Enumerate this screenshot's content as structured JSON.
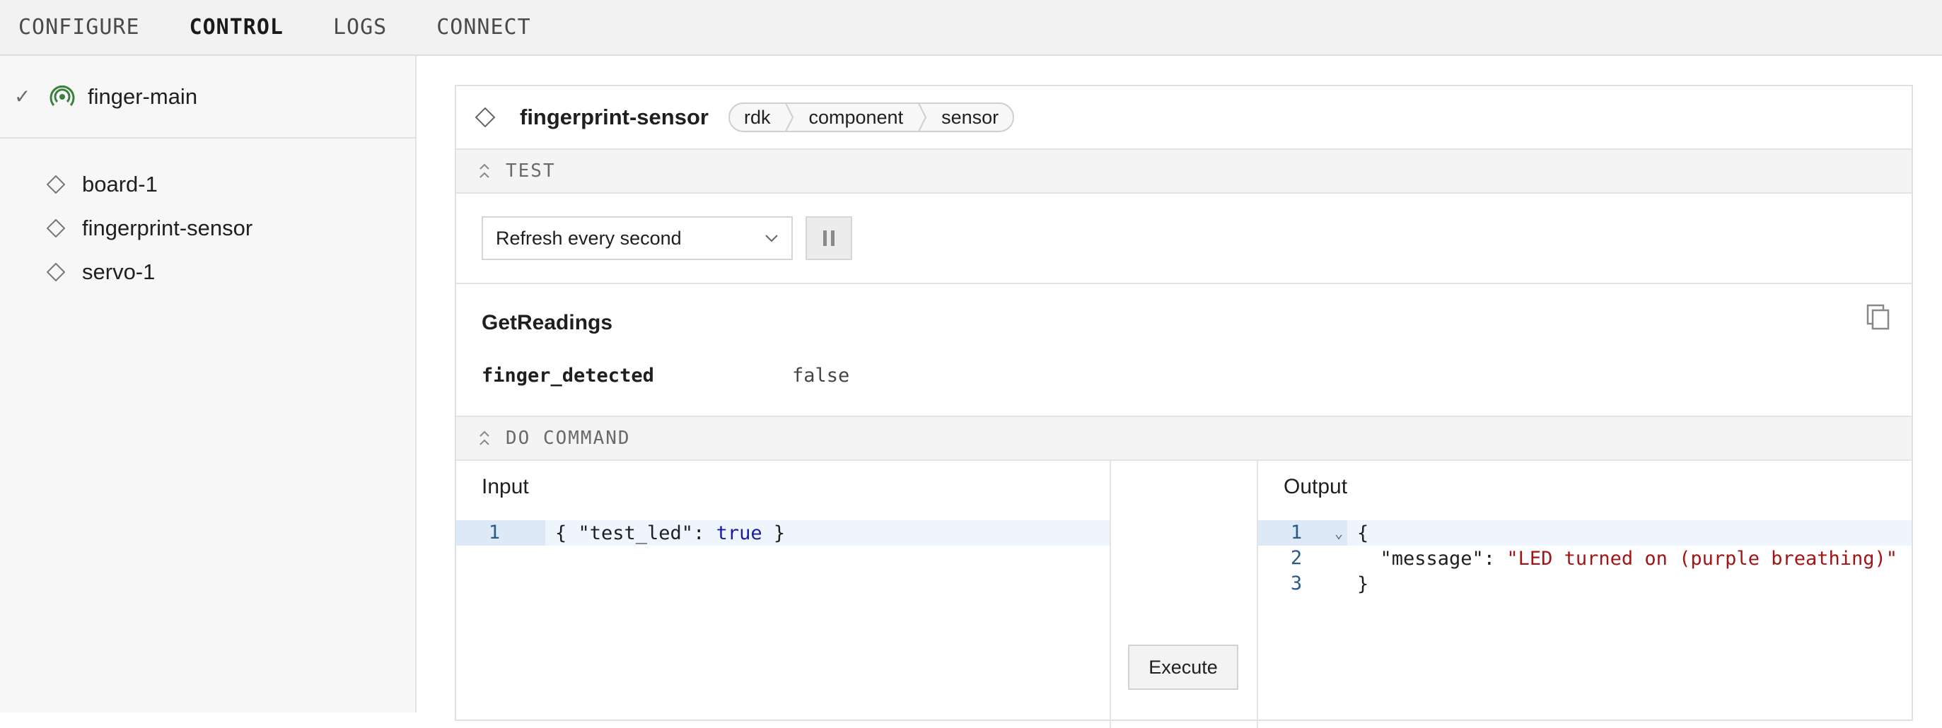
{
  "nav": {
    "tabs": [
      "CONFIGURE",
      "CONTROL",
      "LOGS",
      "CONNECT"
    ],
    "active": "CONTROL"
  },
  "sidebar": {
    "robot": {
      "name": "finger-main",
      "status": "online"
    },
    "resources": [
      "board-1",
      "fingerprint-sensor",
      "servo-1"
    ]
  },
  "card": {
    "title": "fingerprint-sensor",
    "breadcrumb": [
      "rdk",
      "component",
      "sensor"
    ],
    "test_section": {
      "label": "TEST",
      "refresh_option": "Refresh every second",
      "readings_heading": "GetReadings",
      "readings": [
        {
          "key": "finger_detected",
          "value": "false"
        }
      ]
    },
    "do_command": {
      "label": "DO COMMAND",
      "input_title": "Input",
      "input_lines": [
        {
          "n": "1",
          "code": "{ \"test_led\": true }"
        }
      ],
      "execute_label": "Execute",
      "output_title": "Output",
      "output_lines": [
        {
          "n": "1",
          "code": "{"
        },
        {
          "n": "2",
          "code": "  \"message\": \"LED turned on (purple breathing)\""
        },
        {
          "n": "3",
          "code": "}"
        }
      ]
    }
  },
  "colors": {
    "signal_green": "#3d7f3d",
    "accent_blue": "#2b5a8a",
    "string_red": "#a31515",
    "keyword_blue": "#1a1aa6"
  }
}
